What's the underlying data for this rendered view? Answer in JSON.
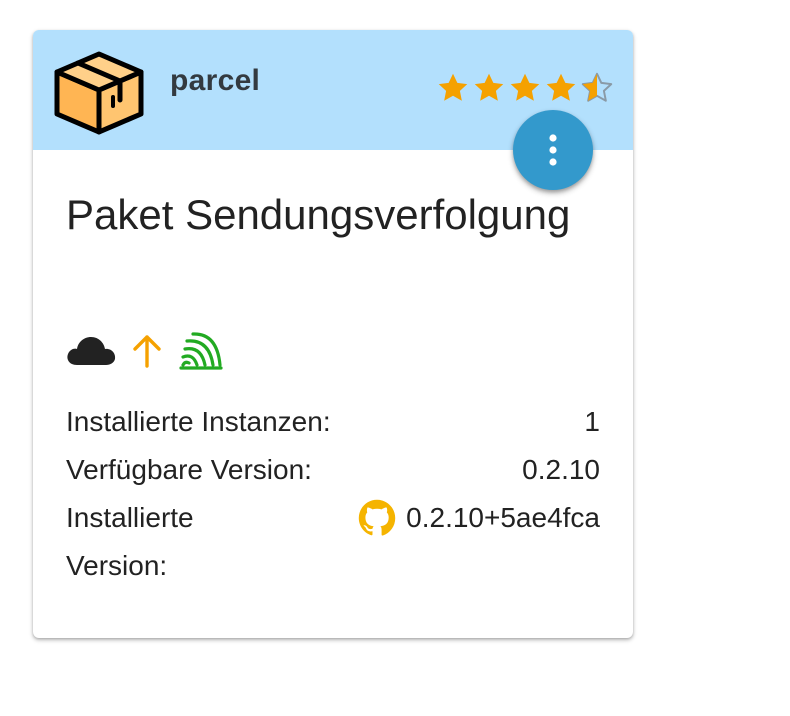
{
  "adapter": {
    "name": "parcel",
    "title": "Paket Sendungsverfolgung",
    "rating_stars": 4.5,
    "rating_max": 5,
    "icon": "package-box-icon"
  },
  "header": {
    "background": "#b3e0fd"
  },
  "fab": {
    "icon": "more-vertical-icon",
    "color": "#3399cc"
  },
  "status_icons": [
    {
      "name": "cloud-icon",
      "color": "#222222"
    },
    {
      "name": "arrow-up-icon",
      "color": "#f5a100"
    },
    {
      "name": "signal-icon",
      "color": "#22aa22"
    }
  ],
  "info": {
    "installed_instances_label": "Installierte Instanzen:",
    "installed_instances_value": "1",
    "available_version_label": "Verfügbare Version:",
    "available_version_value": "0.2.10",
    "installed_version_label": "Installierte Version:",
    "installed_version_value": "0.2.10+5ae4fca",
    "installed_version_source_icon": "github-icon",
    "github_icon_color": "#f5b400"
  }
}
